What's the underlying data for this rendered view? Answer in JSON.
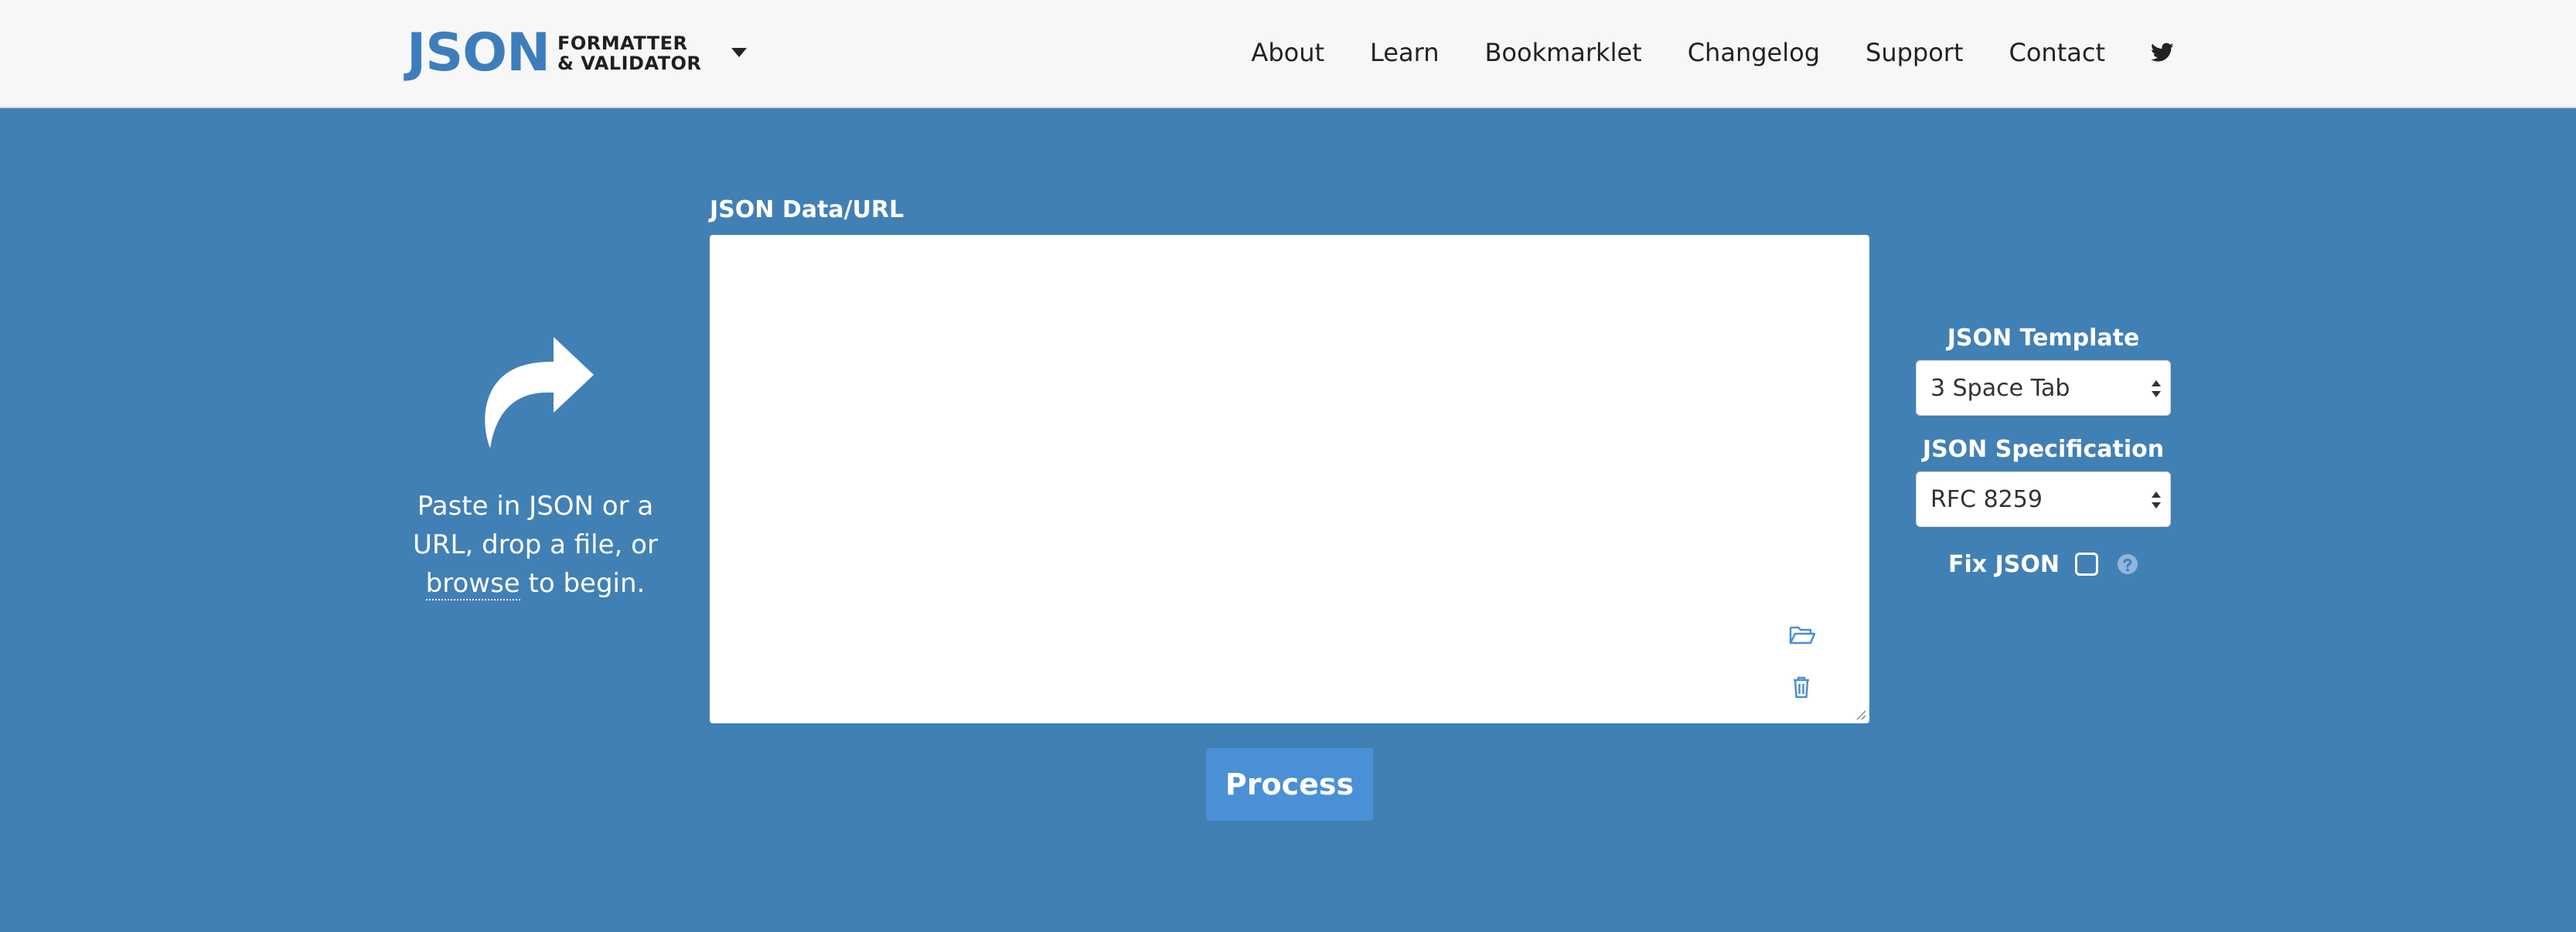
{
  "header": {
    "logo_main": "JSON",
    "logo_line1": "FORMATTER",
    "logo_line2": "& VALIDATOR",
    "nav": [
      {
        "label": "About"
      },
      {
        "label": "Learn"
      },
      {
        "label": "Bookmarklet"
      },
      {
        "label": "Changelog"
      },
      {
        "label": "Support"
      },
      {
        "label": "Contact"
      }
    ],
    "social_icon": "twitter-icon"
  },
  "helper": {
    "icon": "share-arrow-icon",
    "text_before": "Paste in JSON or a URL, drop a file, or",
    "browse_link": "browse",
    "text_after": "to begin."
  },
  "editor": {
    "label": "JSON Data/URL",
    "value": "",
    "icons": [
      "folder-open-icon",
      "trash-icon"
    ]
  },
  "process_button": "Process",
  "options": {
    "template_label": "JSON Template",
    "template_value": "3 Space Tab",
    "spec_label": "JSON Specification",
    "spec_value": "RFC 8259",
    "fix_label": "Fix JSON",
    "fix_checked": false
  },
  "colors": {
    "background": "#4180b5",
    "header_bg": "#f7f7f7",
    "logo_blue": "#3e7dbd",
    "button": "#4a90d6"
  }
}
